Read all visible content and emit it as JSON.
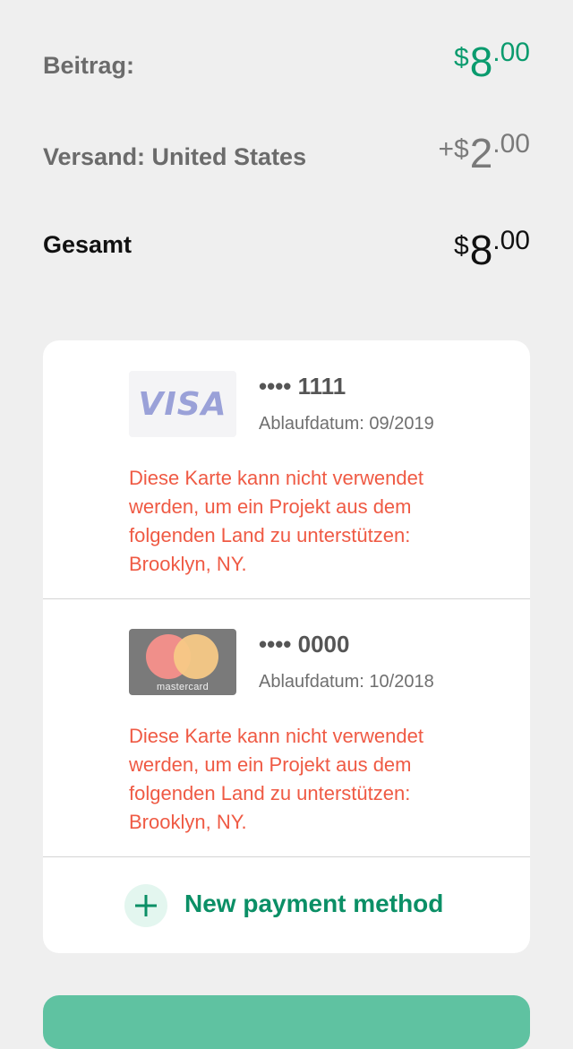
{
  "summary": {
    "subtotal": {
      "label": "Beitrag:",
      "prefix": "$",
      "whole": "8",
      "cents": ".00",
      "color": "#0a9b6e"
    },
    "shipping": {
      "label": "Versand: United States",
      "prefix": "+$",
      "whole": "2",
      "cents": ".00"
    },
    "total": {
      "label": "Gesamt",
      "prefix": "$",
      "whole": "8",
      "cents": ".00"
    }
  },
  "payment_methods": [
    {
      "brand": "VISA",
      "masked_number": "•••• 1111",
      "expiry": "Ablaufdatum: 09/2019",
      "error": "Diese Karte kann nicht verwendet werden, um ein Projekt aus dem folgenden Land zu unterstützen: Brooklyn, NY.",
      "icon": "visa-logo"
    },
    {
      "brand": "mastercard",
      "masked_number": "•••• 0000",
      "expiry": "Ablaufdatum: 10/2018",
      "error": "Diese Karte kann nicht verwendet werden, um ein Projekt aus dem folgenden Land zu unterstützen: Brooklyn, NY.",
      "icon": "mastercard-logo"
    }
  ],
  "new_payment": {
    "label": "New payment method",
    "icon": "plus-icon"
  },
  "colors": {
    "accent": "#0b8f66",
    "error": "#ef5a44",
    "button": "#5fc2a1",
    "background": "#efefef"
  }
}
